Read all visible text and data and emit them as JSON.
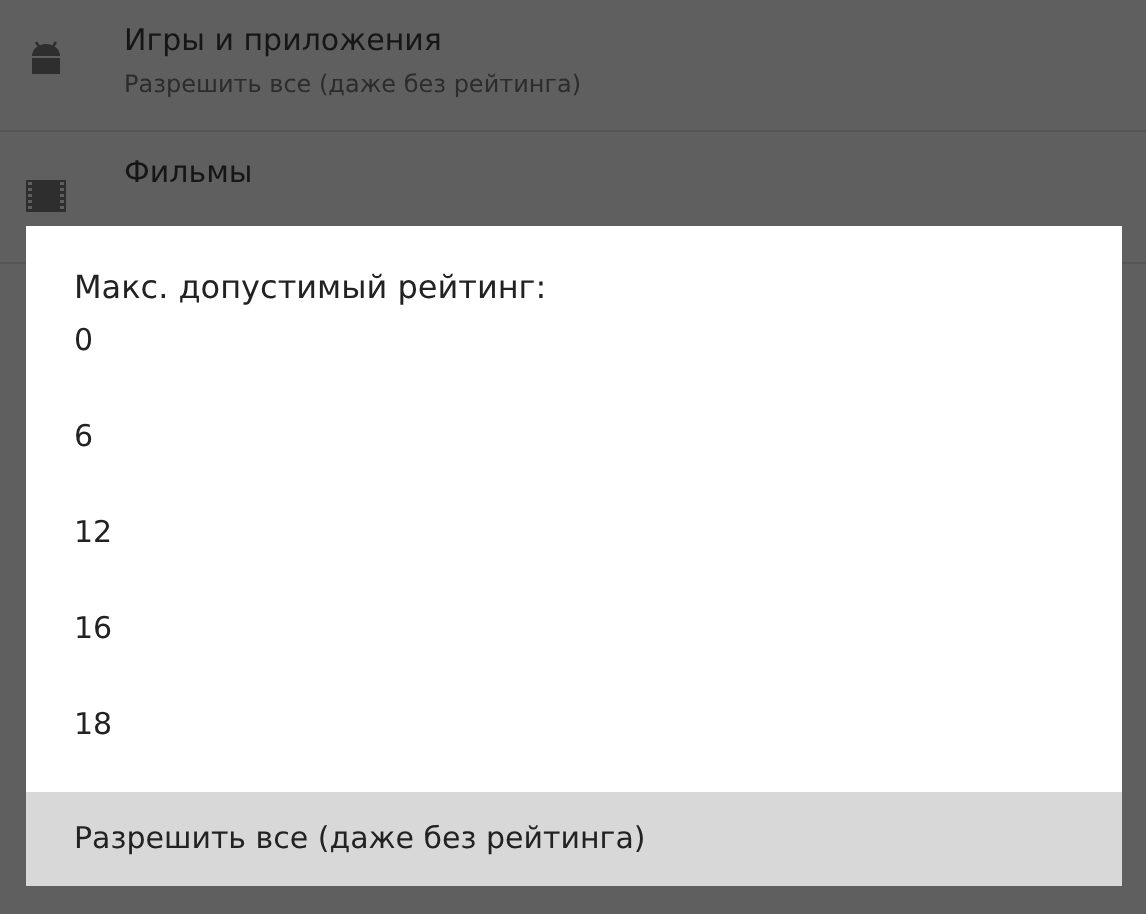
{
  "settings": [
    {
      "title": "Игры и приложения",
      "summary": "Разрешить все (даже без рейтинга)",
      "kind": "app"
    },
    {
      "title": "Фильмы",
      "kind": "movie"
    }
  ],
  "dialog": {
    "title": "Макс. допустимый рейтинг:",
    "options": [
      {
        "label": "0",
        "selected": false
      },
      {
        "label": "6",
        "selected": false
      },
      {
        "label": "12",
        "selected": false
      },
      {
        "label": "16",
        "selected": false
      },
      {
        "label": "18",
        "selected": false
      },
      {
        "label": "Разрешить все (даже без рейтинга)",
        "selected": true
      }
    ]
  }
}
